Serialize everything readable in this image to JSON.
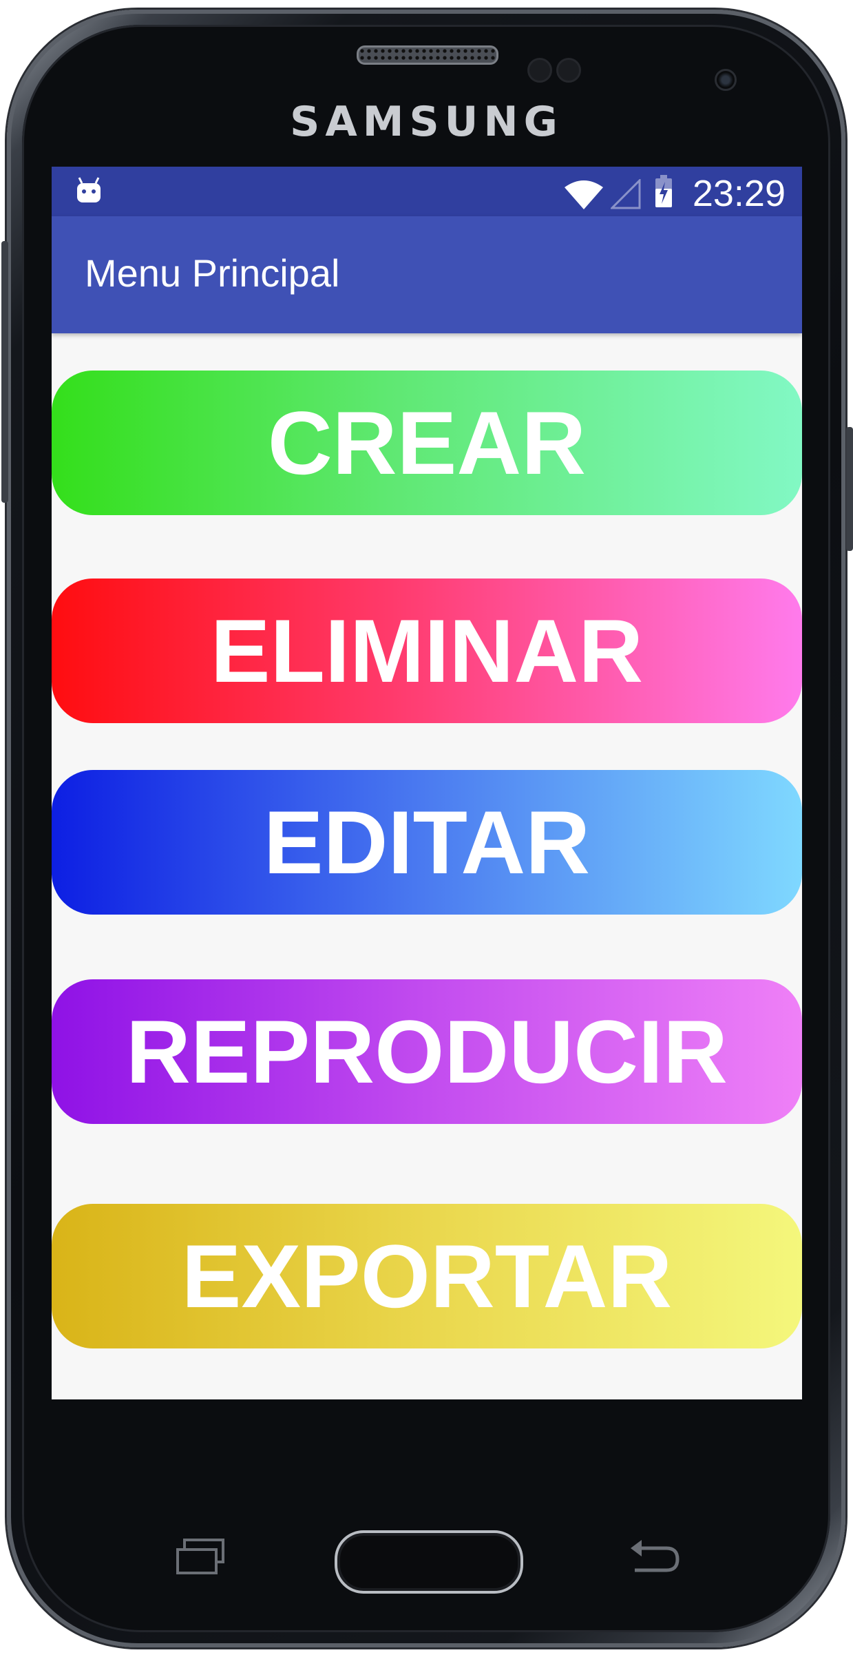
{
  "device": {
    "brand": "SAMSUNG"
  },
  "status_bar": {
    "time": "23:29",
    "icons": [
      "android-notification-icon",
      "wifi-icon",
      "signal-icon",
      "battery-charging-icon"
    ]
  },
  "app_bar": {
    "title": "Menu Principal"
  },
  "menu": {
    "buttons": [
      {
        "label": "CREAR",
        "gradient": [
          "#34df1b",
          "#82f8c4"
        ]
      },
      {
        "label": "ELIMINAR",
        "gradient": [
          "#ff0d10",
          "#ff7bec"
        ]
      },
      {
        "label": "EDITAR",
        "gradient": [
          "#0d1fe3",
          "#7fd8ff"
        ]
      },
      {
        "label": "REPRODUCIR",
        "gradient": [
          "#8f12e6",
          "#ef80f7"
        ]
      },
      {
        "label": "EXPORTAR",
        "gradient": [
          "#d9b418",
          "#f4f77c"
        ]
      }
    ]
  },
  "navigation_keys": [
    "recent-apps-icon",
    "home-button",
    "back-icon"
  ]
}
